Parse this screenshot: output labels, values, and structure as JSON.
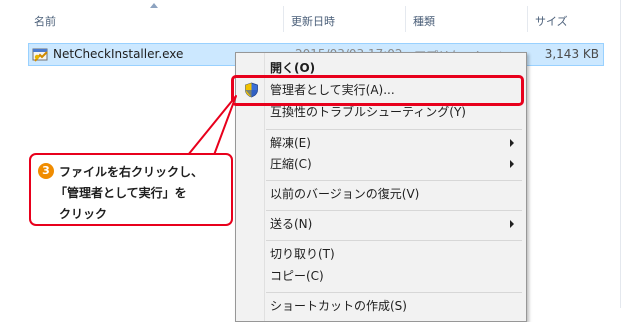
{
  "header": {
    "col_name": "名前",
    "col_date": "更新日時",
    "col_type": "種類",
    "col_size": "サイズ"
  },
  "file": {
    "name": "NetCheckInstaller.exe",
    "date": "2015/03/03 17:02",
    "type": "アプリケーション",
    "size": "3,143 KB"
  },
  "menu": {
    "items": [
      {
        "label": "開く(O)"
      },
      {
        "label": "管理者として実行(A)..."
      },
      {
        "label": "互換性のトラブルシューティング(Y)"
      },
      {
        "label": "解凍(E)"
      },
      {
        "label": "圧縮(C)"
      },
      {
        "label": "以前のバージョンの復元(V)"
      },
      {
        "label": "送る(N)"
      },
      {
        "label": "切り取り(T)"
      },
      {
        "label": "コピー(C)"
      },
      {
        "label": "ショートカットの作成(S)"
      }
    ]
  },
  "callout": {
    "number": "3",
    "line1": "ファイルを右クリックし、",
    "line2": "「管理者として実行」を",
    "line3": "クリック"
  },
  "colors": {
    "highlight": "#e8001c",
    "selection": "#cce8ff",
    "badge": "#f08c00"
  }
}
